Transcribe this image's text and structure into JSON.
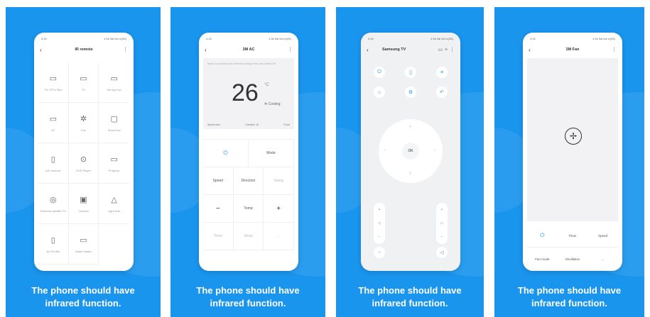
{
  "caption": {
    "line1": "The phone should have",
    "line2": "infrared function."
  },
  "status_bar": {
    "left": "4:16",
    "right": "4.5k 5al 5al ◂ (83)"
  },
  "screen1": {
    "title": "IR remote",
    "devices": [
      {
        "icon": "▭",
        "label": "TV/ IPTV/ Box"
      },
      {
        "icon": "▭",
        "label": "TV"
      },
      {
        "icon": "▭",
        "label": "Set-top box"
      },
      {
        "icon": "▭",
        "label": "AC"
      },
      {
        "icon": "✲",
        "label": "Fan"
      },
      {
        "icon": "▢",
        "label": "Smart box"
      },
      {
        "icon": "▯",
        "label": "A/V receiver"
      },
      {
        "icon": "⊙",
        "label": "DVD Player"
      },
      {
        "icon": "▭",
        "label": "Projector"
      },
      {
        "icon": "◎",
        "label": "Ethernet satellite TV"
      },
      {
        "icon": "▣",
        "label": "Camera"
      },
      {
        "icon": "△",
        "label": "Light bulb"
      },
      {
        "icon": "▯",
        "label": "Air Purifier"
      },
      {
        "icon": "▭",
        "label": "Water heater"
      }
    ]
  },
  "screen2": {
    "title": "3M AC",
    "temperature": "26",
    "unit": "°C",
    "mode_text": "Cooling",
    "info": "Mode Cool Speed Auto Direction Swing Fixed Low (Timer) Off",
    "row": [
      "Speed Auto",
      "Direction 15",
      "Fixed"
    ],
    "buttons": [
      "Mode",
      "Speed",
      "Direction",
      "Swing",
      "−",
      "Temp",
      "+",
      "Timer",
      "Sleep",
      "..."
    ]
  },
  "screen3": {
    "title": "Samsung TV",
    "ok": "OK"
  },
  "screen4": {
    "title": "3M Fan",
    "buttons": [
      "Timer",
      "Speed",
      "Fan mode",
      "Oscillation",
      "..."
    ]
  }
}
